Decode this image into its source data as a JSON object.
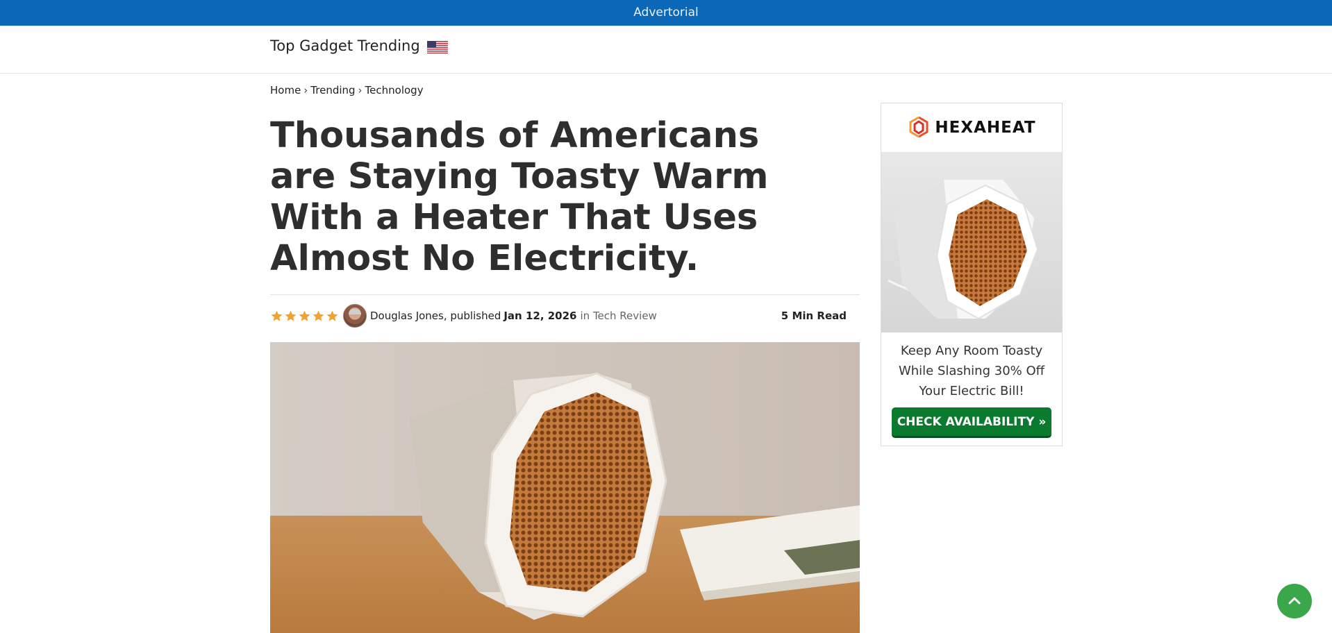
{
  "ad_banner": {
    "label": "Advertorial"
  },
  "header": {
    "site_name": "Top Gadget Trending"
  },
  "breadcrumb": {
    "items": [
      "Home",
      "Trending",
      "Technology"
    ],
    "separator": "›"
  },
  "article": {
    "headline": "Thousands of Americans are Staying Toasty Warm With a Heater That Uses Almost No Electricity.",
    "rating": 5,
    "author_text": "Douglas Jones, published",
    "date": "Jan 12, 2026",
    "category_text": "in Tech Review",
    "read_time": "5 Min Read"
  },
  "sidebar_ad": {
    "brand": "HEXAHEAT",
    "tagline": "Keep Any Room Toasty While Slashing 30% Off Your Electric Bill!",
    "cta_label": "CHECK AVAILABILITY »"
  },
  "colors": {
    "ad_bar": "#0b68b8",
    "cta_green": "#0a7a2e",
    "star": "#f0a330",
    "back_to_top": "#3aa74a"
  },
  "icons": [
    "us-flag-icon",
    "star-icon",
    "hexaheat-logo-icon",
    "chevron-up-icon"
  ]
}
